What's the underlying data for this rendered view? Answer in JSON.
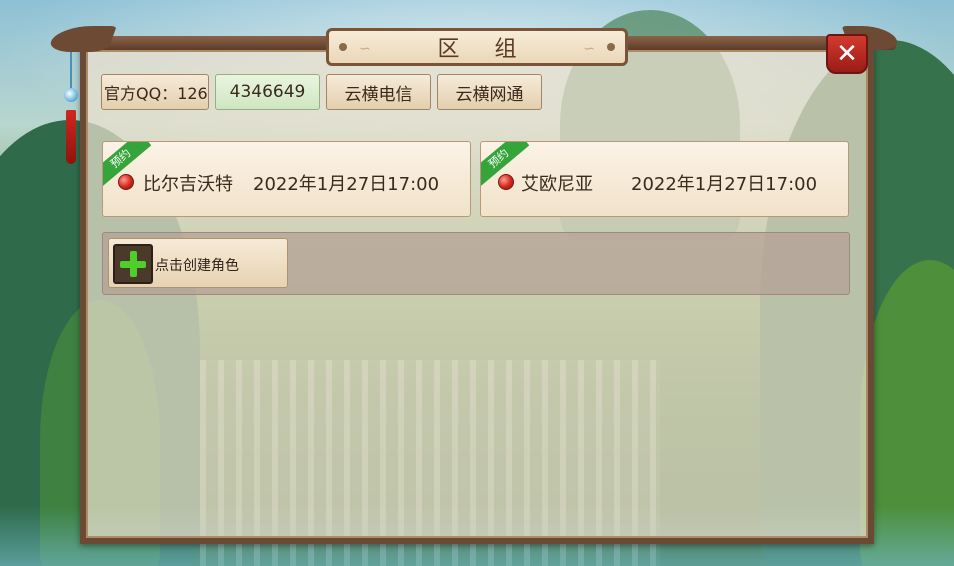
{
  "window": {
    "title": "区 组",
    "close_label": "✕"
  },
  "top_buttons": [
    {
      "label": "官方QQ：126",
      "state": "normal"
    },
    {
      "label": "4346649",
      "state": "selected"
    },
    {
      "label": "云横电信",
      "state": "normal"
    },
    {
      "label": "云横网通",
      "state": "normal"
    }
  ],
  "servers": [
    {
      "badge": "预约",
      "name": "比尔吉沃特",
      "open_time": "2022年1月27日17:00",
      "status_color": "#d3261b"
    },
    {
      "badge": "预约",
      "name": "艾欧尼亚",
      "open_time": "2022年1月27日17:00",
      "status_color": "#d3261b"
    }
  ],
  "create_role": {
    "label": "点击创建角色",
    "icon": "plus-icon"
  },
  "colors": {
    "frame": "#6b4a35",
    "selected_tab": "#cfe6c2",
    "ribbon": "#35a53b",
    "close": "#d23a2f"
  }
}
